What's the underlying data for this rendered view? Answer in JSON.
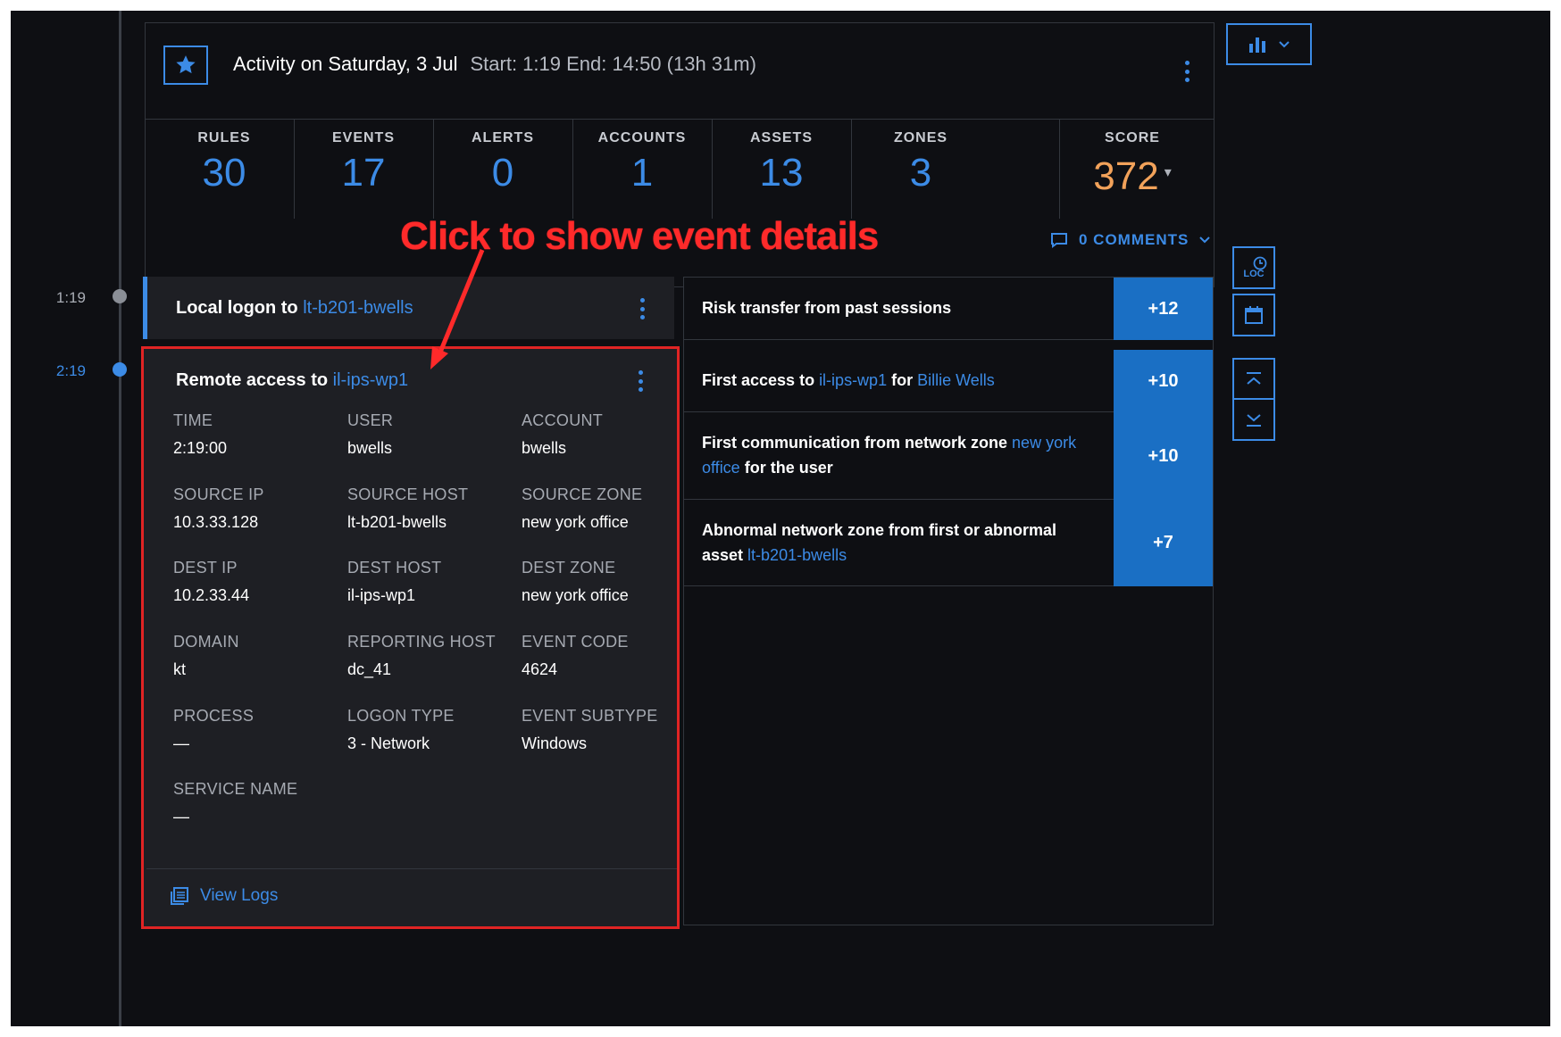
{
  "timeline": {
    "times": [
      "1:19",
      "2:19"
    ]
  },
  "header": {
    "title": "Activity on Saturday, 3 Jul",
    "range": "Start: 1:19 End: 14:50 (13h 31m)"
  },
  "stats": [
    {
      "label": "RULES",
      "value": "30"
    },
    {
      "label": "EVENTS",
      "value": "17"
    },
    {
      "label": "ALERTS",
      "value": "0"
    },
    {
      "label": "ACCOUNTS",
      "value": "1"
    },
    {
      "label": "ASSETS",
      "value": "13"
    },
    {
      "label": "ZONES",
      "value": "3"
    },
    {
      "label": "SCORE",
      "value": "372"
    }
  ],
  "comments_label": "0 COMMENTS",
  "annotation": "Click to show event details",
  "events": [
    {
      "prefix": "Local logon to ",
      "host": "lt-b201-bwells"
    },
    {
      "prefix": "Remote access to ",
      "host": "il-ips-wp1"
    }
  ],
  "details": {
    "fields": [
      {
        "label": "TIME",
        "value": "2:19:00"
      },
      {
        "label": "USER",
        "value": "bwells"
      },
      {
        "label": "ACCOUNT",
        "value": "bwells"
      },
      {
        "label": "SOURCE IP",
        "value": "10.3.33.128"
      },
      {
        "label": "SOURCE HOST",
        "value": "lt-b201-bwells"
      },
      {
        "label": "SOURCE ZONE",
        "value": "new york office"
      },
      {
        "label": "DEST IP",
        "value": "10.2.33.44"
      },
      {
        "label": "DEST HOST",
        "value": "il-ips-wp1"
      },
      {
        "label": "DEST ZONE",
        "value": "new york office"
      },
      {
        "label": "DOMAIN",
        "value": "kt"
      },
      {
        "label": "REPORTING HOST",
        "value": "dc_41"
      },
      {
        "label": "EVENT CODE",
        "value": "4624"
      },
      {
        "label": "PROCESS",
        "value": "—"
      },
      {
        "label": "LOGON TYPE",
        "value": "3 - Network"
      },
      {
        "label": "EVENT SUBTYPE",
        "value": "Windows"
      },
      {
        "label": "SERVICE NAME",
        "value": "—"
      }
    ],
    "view_logs": "View Logs"
  },
  "risks": [
    {
      "parts": [
        {
          "t": "Risk transfer from past sessions",
          "link": false
        }
      ],
      "score": "+12"
    },
    {
      "parts": [
        {
          "t": "First access to ",
          "link": false
        },
        {
          "t": "il-ips-wp1",
          "link": true
        },
        {
          "t": " for ",
          "link": false
        },
        {
          "t": "Billie Wells",
          "link": true
        }
      ],
      "score": "+10"
    },
    {
      "parts": [
        {
          "t": "First communication from network zone ",
          "link": false
        },
        {
          "t": "new york office",
          "link": true
        },
        {
          "t": " for the user",
          "link": false
        }
      ],
      "score": "+10"
    },
    {
      "parts": [
        {
          "t": "Abnormal network zone from first or abnormal asset ",
          "link": false
        },
        {
          "t": "lt-b201-bwells",
          "link": true
        }
      ],
      "score": "+7"
    }
  ],
  "side": {
    "loc_label": "LOC"
  },
  "colors": {
    "accent": "#3c8be6",
    "score": "#f2a25a",
    "annotation": "#ff2a2a",
    "risk_score_bg": "#1a6fc4"
  }
}
